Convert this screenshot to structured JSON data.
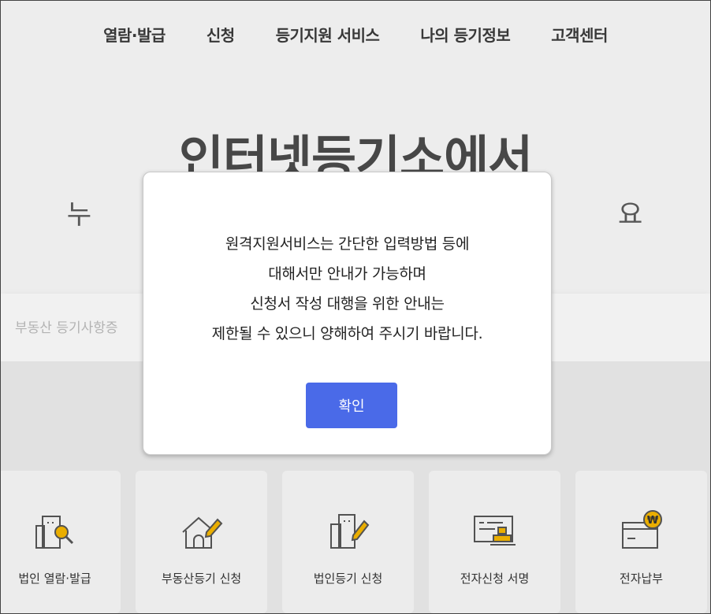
{
  "nav": {
    "items": [
      {
        "label": "열람·발급"
      },
      {
        "label": "신청"
      },
      {
        "label": "등기지원 서비스"
      },
      {
        "label": "나의 등기정보"
      },
      {
        "label": "고객센터"
      }
    ]
  },
  "hero": {
    "title": "인터넷등기소에서",
    "subtitle": "누                                                    요"
  },
  "search": {
    "placeholder": "부동산 등기사항증"
  },
  "modal": {
    "lines": [
      "원격지원서비스는 간단한 입력방법 등에",
      "대해서만 안내가 가능하며",
      "신청서 작성 대행을 위한 안내는",
      "제한될 수 있으니 양해하여 주시기 바랍니다."
    ],
    "confirm_label": "확인"
  },
  "services": [
    {
      "label": "법인 열람·발급",
      "icon": "building-search-icon"
    },
    {
      "label": "부동산등기 신청",
      "icon": "house-pen-icon"
    },
    {
      "label": "법인등기 신청",
      "icon": "building-pen-icon"
    },
    {
      "label": "전자신청 서명",
      "icon": "document-stamp-icon"
    },
    {
      "label": "전자납부",
      "icon": "wallet-won-icon"
    }
  ],
  "colors": {
    "accent": "#4a6ae8",
    "icon_yellow": "#f2b400",
    "icon_stroke": "#555555"
  }
}
